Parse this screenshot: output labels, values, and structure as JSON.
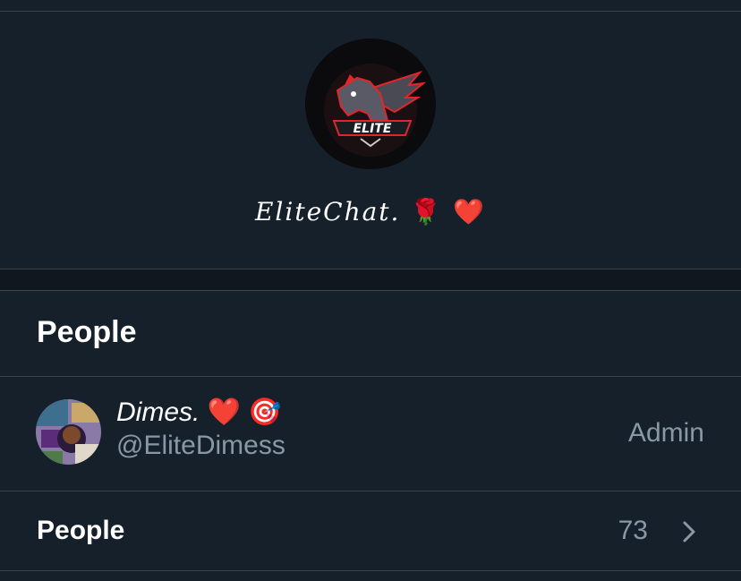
{
  "group": {
    "name": "EliteChat.",
    "name_emoji": "🌹 ❤️",
    "logo_text": "ELITE"
  },
  "people_section": {
    "title": "People"
  },
  "member": {
    "display_name": "Dimes.",
    "name_emoji": "❤️ 🎯",
    "handle": "@EliteDimess",
    "role": "Admin"
  },
  "people_row": {
    "label": "People",
    "count": "73"
  },
  "colors": {
    "background": "#15202b",
    "divider": "#38444d",
    "secondary_text": "#8899a6",
    "logo_accent": "#e0262b"
  },
  "icons": [
    "pegasus-logo-icon",
    "chevron-right-icon"
  ]
}
